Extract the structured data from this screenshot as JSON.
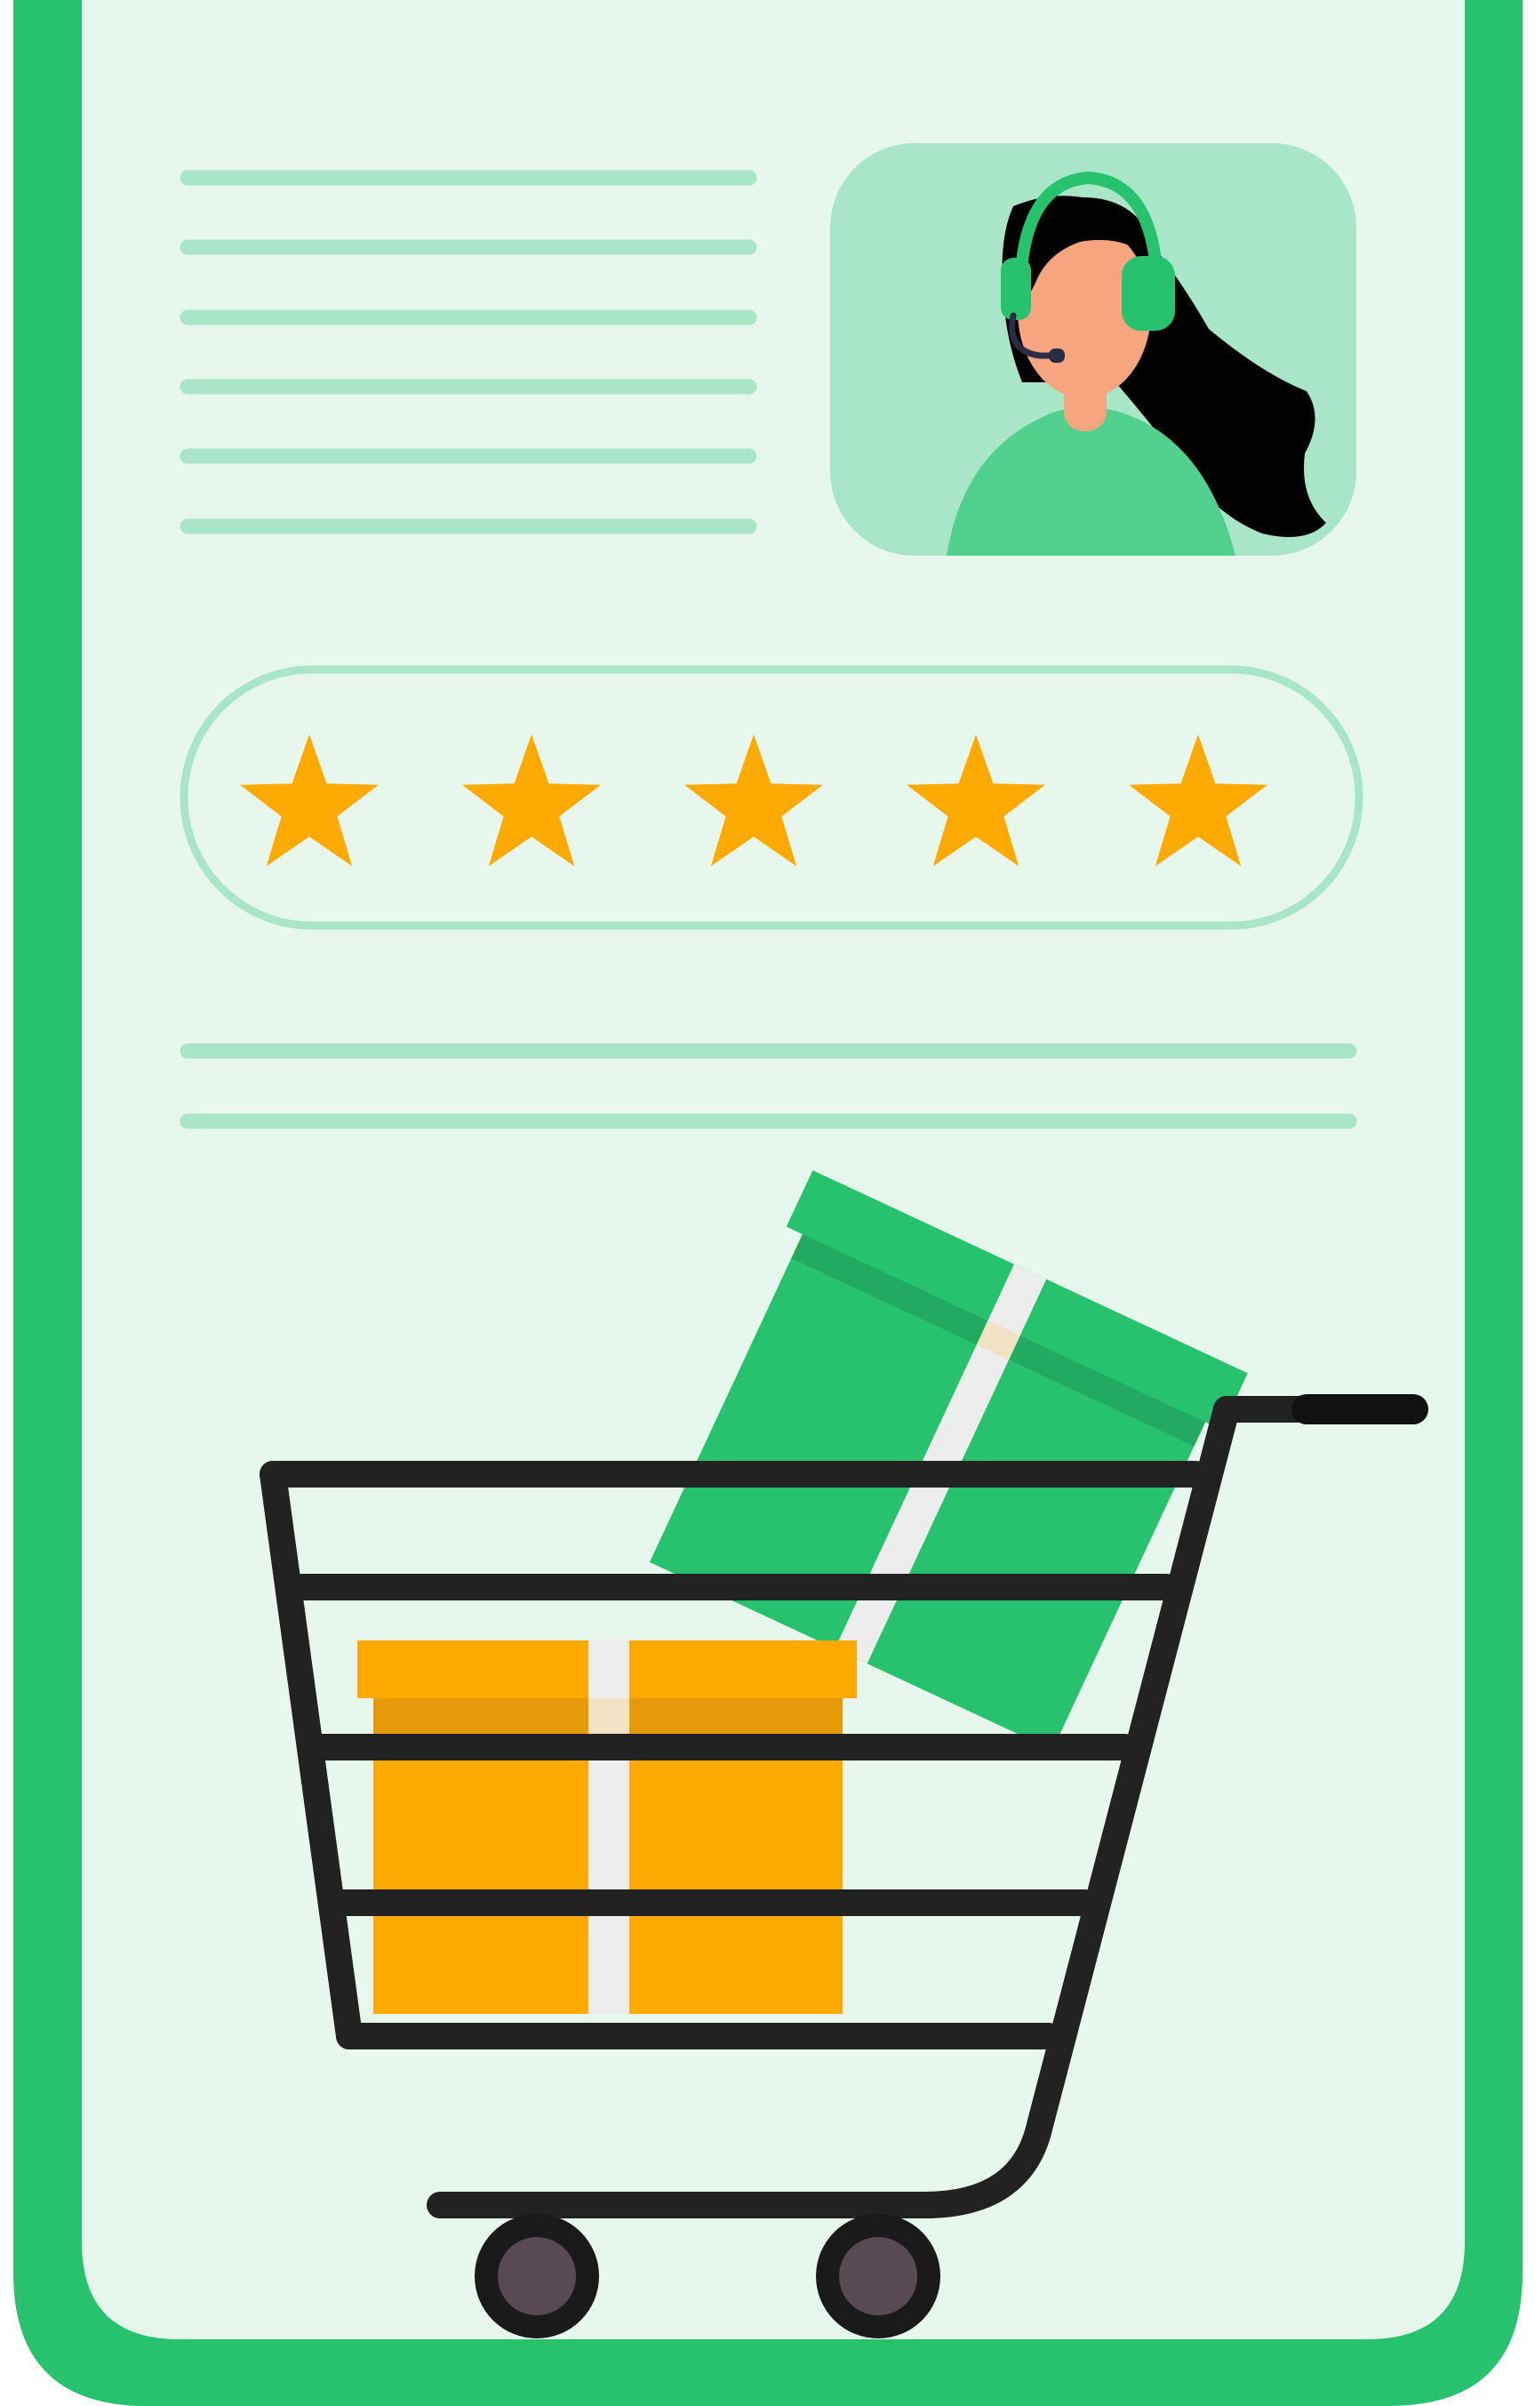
{
  "palette": {
    "frame": "#26C26D",
    "screen": "#E8F7EE",
    "placeholder_line": "#A9E6C8",
    "avatar_bg": "#A9E6C8",
    "star": "#FFAA00",
    "cart_wire": "#222222",
    "wheel": "#574A52",
    "box_orange": "#FFAA00",
    "box_green": "#26C26D",
    "ribbon": "#EDEDED"
  },
  "rating": {
    "stars_filled": 5,
    "stars_total": 5
  },
  "icons": {
    "agent_avatar": "support-agent-headset-icon",
    "rating": "star-icon",
    "cart": "shopping-cart-icon",
    "boxes": "gift-box-icon"
  }
}
